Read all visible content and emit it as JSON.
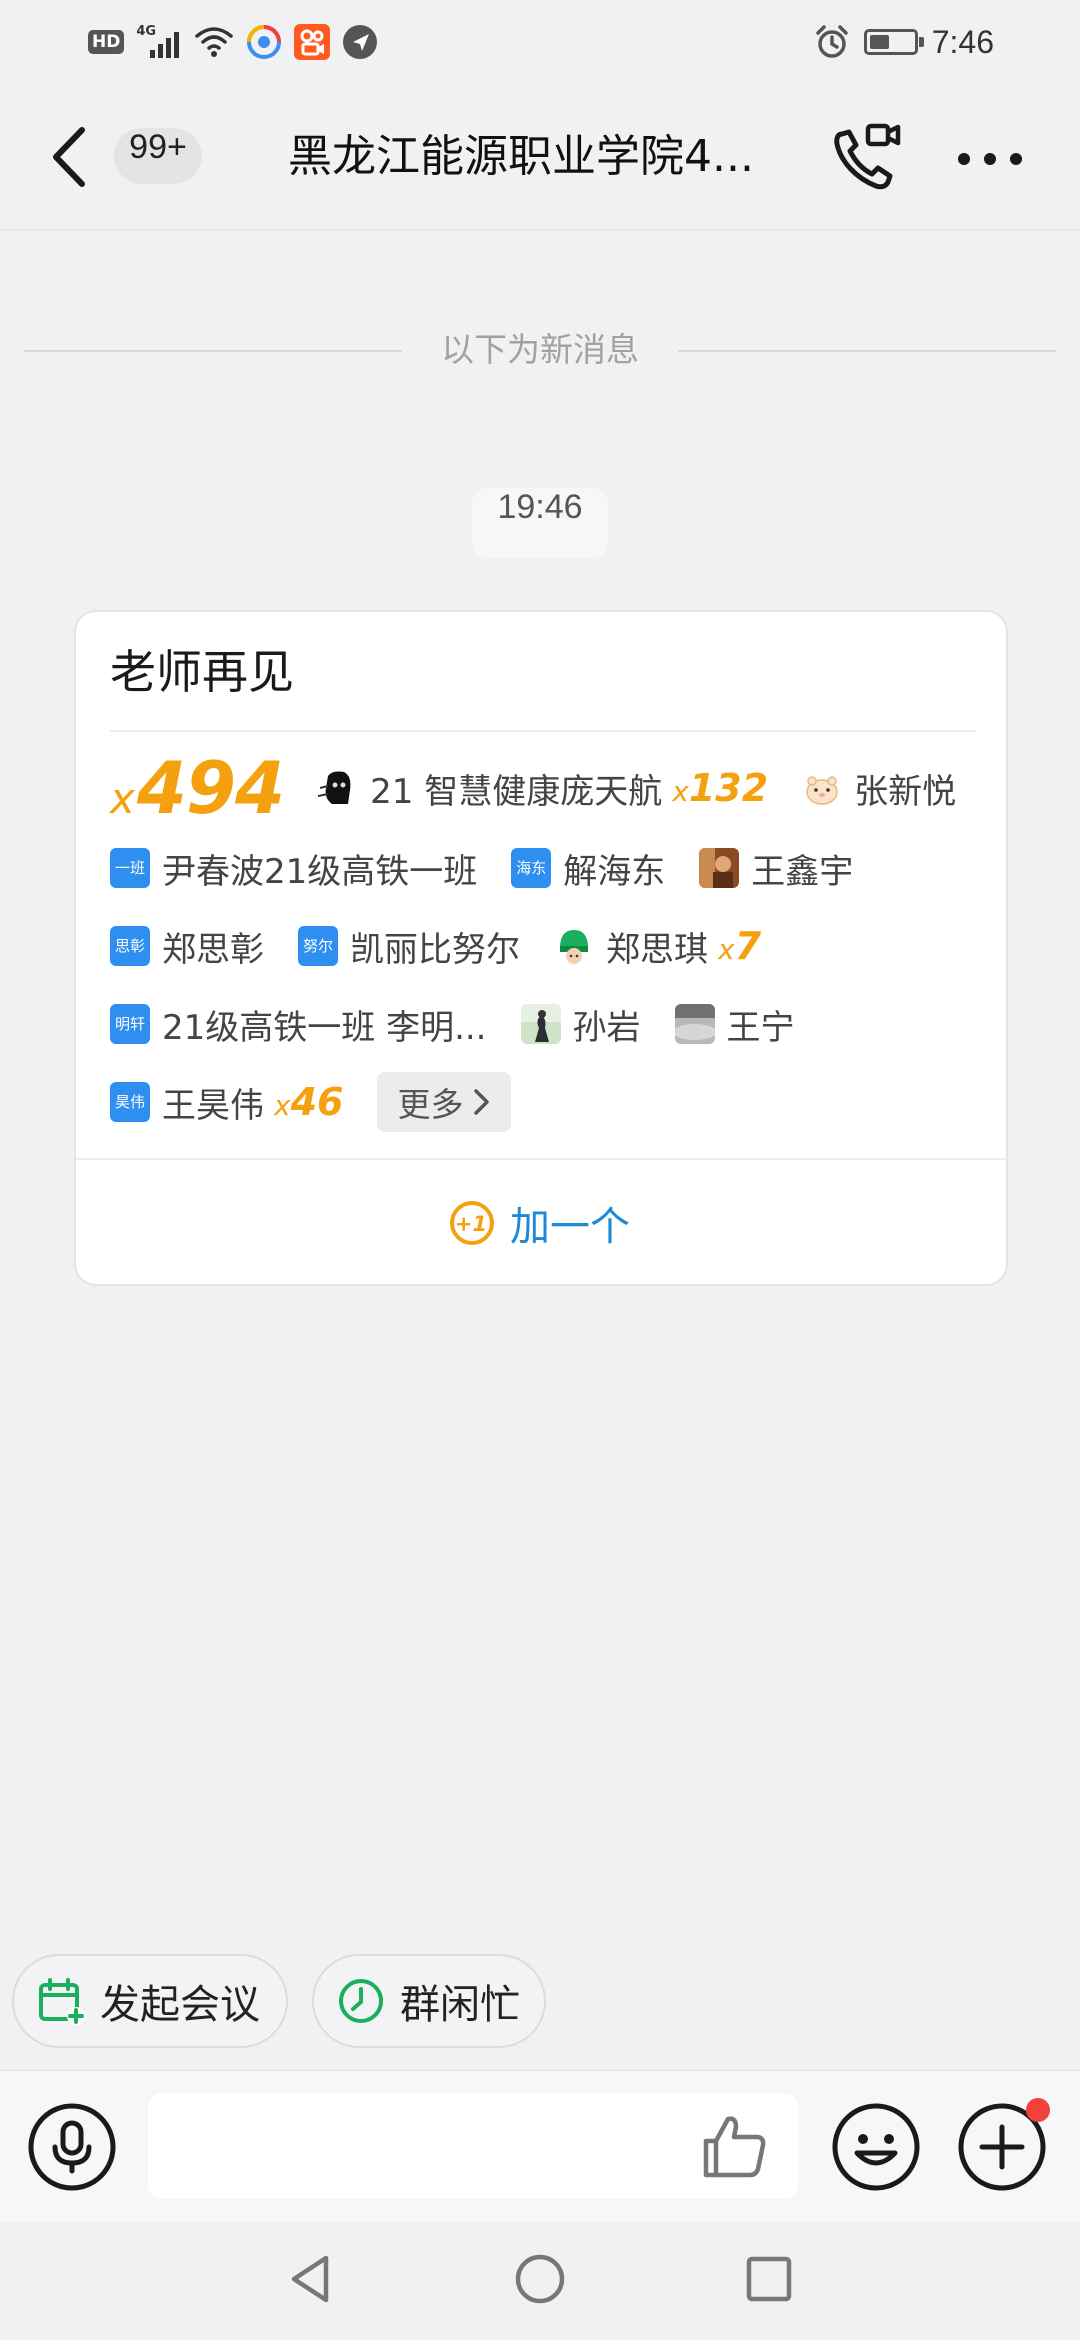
{
  "status_bar": {
    "hd": "HD",
    "network": "4G",
    "time": "7:46",
    "battery_level": 0.4,
    "icons": [
      "hd-icon",
      "signal-icon",
      "wifi-icon",
      "app-notification-icon",
      "kuaishou-icon",
      "location-icon",
      "alarm-icon",
      "battery-icon"
    ]
  },
  "header": {
    "unread_count": "99+",
    "title": "黑龙江能源职业学院4...",
    "icons": {
      "back": "back-arrow-icon",
      "call": "video-call-icon",
      "more": "more-dots-icon"
    }
  },
  "chat": {
    "new_messages_divider": "以下为新消息",
    "timestamp": "19:46"
  },
  "relay_card": {
    "title": "老师再见",
    "total_prefix": "x",
    "total_count": "494",
    "participants": [
      {
        "name": "21 智慧健康庞天航",
        "avatar": "dark-figure",
        "avatar_text": "",
        "mult_prefix": "x",
        "mult": "132"
      },
      {
        "name": "张新悦",
        "avatar": "hamster",
        "avatar_text": "",
        "mult_prefix": "",
        "mult": ""
      },
      {
        "name": "尹春波21级高铁一班",
        "avatar": "blue-text",
        "avatar_text": "一班",
        "mult_prefix": "",
        "mult": ""
      },
      {
        "name": "解海东",
        "avatar": "blue-text",
        "avatar_text": "海东",
        "mult_prefix": "",
        "mult": ""
      },
      {
        "name": "王鑫宇",
        "avatar": "photo-brown",
        "avatar_text": "",
        "mult_prefix": "",
        "mult": ""
      },
      {
        "name": "郑思彰",
        "avatar": "blue-text",
        "avatar_text": "思彰",
        "mult_prefix": "",
        "mult": ""
      },
      {
        "name": "凯丽比努尔",
        "avatar": "blue-text",
        "avatar_text": "努尔",
        "mult_prefix": "",
        "mult": ""
      },
      {
        "name": "郑思琪",
        "avatar": "green-helmet",
        "avatar_text": "",
        "mult_prefix": "x",
        "mult": "7"
      },
      {
        "name": "21级高铁一班 李明...",
        "avatar": "blue-text",
        "avatar_text": "明轩",
        "mult_prefix": "",
        "mult": ""
      },
      {
        "name": "孙岩",
        "avatar": "photo-green",
        "avatar_text": "",
        "mult_prefix": "",
        "mult": ""
      },
      {
        "name": "王宁",
        "avatar": "photo-grey",
        "avatar_text": "",
        "mult_prefix": "",
        "mult": ""
      },
      {
        "name": "王昊伟",
        "avatar": "blue-text",
        "avatar_text": "昊伟",
        "mult_prefix": "x",
        "mult": "46"
      }
    ],
    "more_label": "更多",
    "plus_one_label": "加一个",
    "plus_one_icon_text": "+1"
  },
  "quick_actions": [
    {
      "label": "发起会议",
      "icon": "calendar-add-icon"
    },
    {
      "label": "群闲忙",
      "icon": "clock-icon"
    }
  ],
  "input_bar": {
    "message_value": "",
    "icons": {
      "voice": "microphone-icon",
      "like": "thumbs-up-icon",
      "emoji": "emoji-icon",
      "plus": "plus-icon"
    },
    "plus_has_badge": true
  },
  "colors": {
    "accent_orange": "#f5a00f",
    "link_blue": "#1e88d6",
    "avatar_blue": "#2f8ff0",
    "action_green": "#1aaf5d",
    "badge_red": "#f0413e"
  }
}
